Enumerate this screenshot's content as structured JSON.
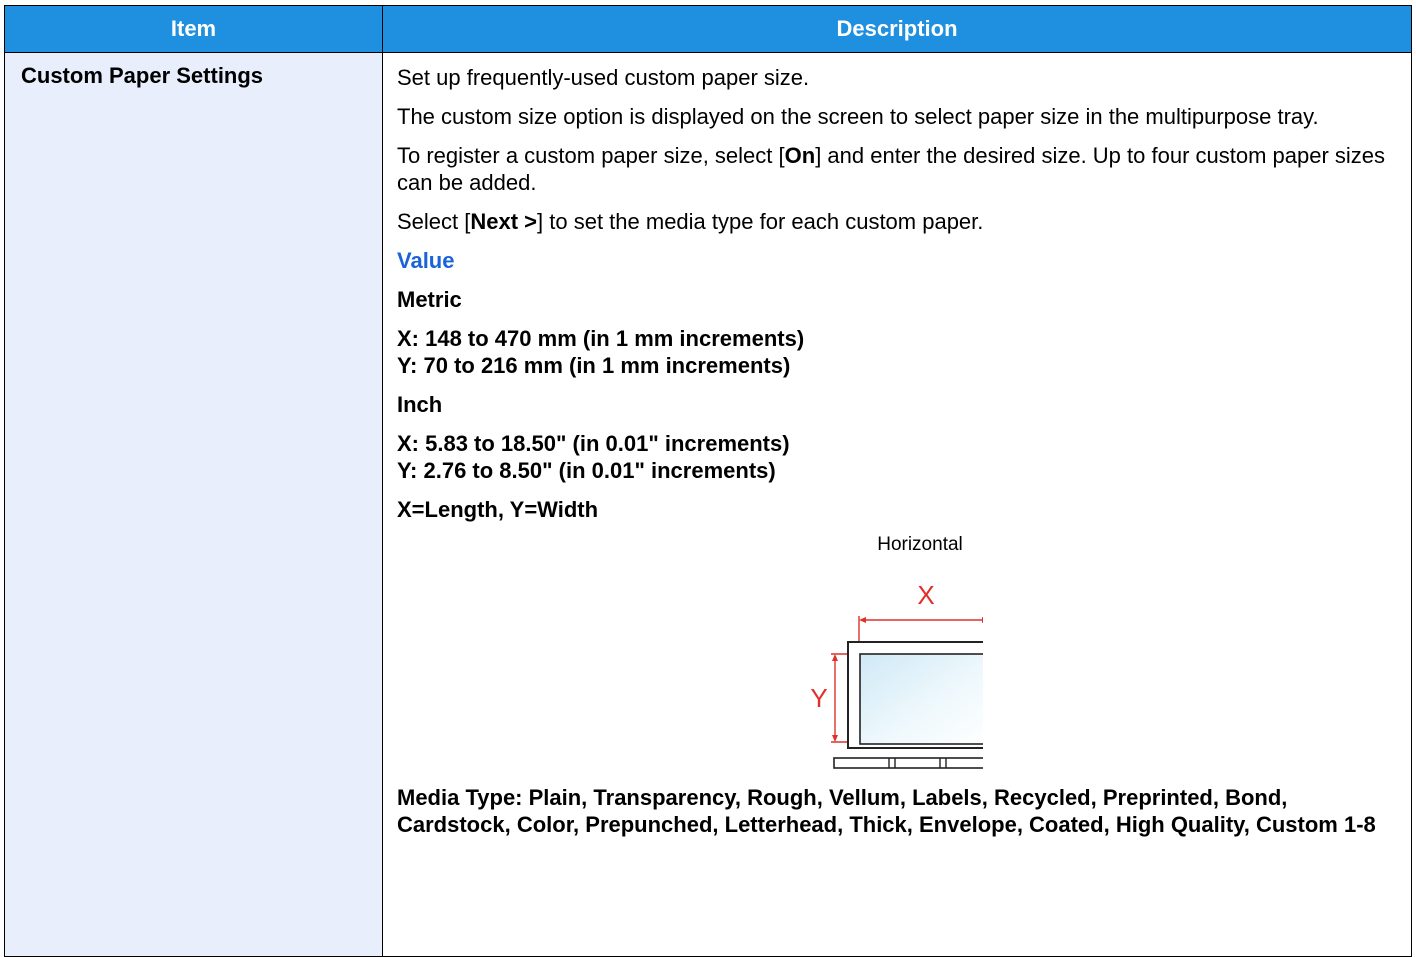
{
  "table": {
    "headers": {
      "item": "Item",
      "description": "Description"
    },
    "row": {
      "item": "Custom Paper Settings",
      "paragraphs": {
        "p1": "Set up frequently-used custom paper size.",
        "p2": "The custom size option is displayed on the screen to select paper size in the multipurpose tray.",
        "p3_a": "To register a custom paper size, select [",
        "p3_b": "On",
        "p3_c": "] and enter the desired size. Up to four custom paper sizes can be added.",
        "p4_a": "Select [",
        "p4_b": "Next >",
        "p4_c": "] to set the media type for each custom paper."
      },
      "value_heading": "Value",
      "metric_label": "Metric",
      "metric_x": "X: 148 to 470 mm (in 1 mm increments)",
      "metric_y": "Y: 70 to 216 mm (in 1 mm increments)",
      "inch_label": "Inch",
      "inch_x": "X: 5.83 to 18.50\" (in 0.01\" increments)",
      "inch_y": "Y: 2.76 to 8.50\" (in 0.01\" increments)",
      "xy_note": "X=Length, Y=Width",
      "figure": {
        "caption": "Horizontal",
        "x_label": "X",
        "y_label": "Y",
        "dim_color": "#e0302a"
      },
      "media_type": "Media Type: Plain, Transparency, Rough, Vellum, Labels, Recycled, Preprinted, Bond, Cardstock, Color, Prepunched, Letterhead, Thick, Envelope, Coated, High Quality, Custom 1-8"
    }
  }
}
